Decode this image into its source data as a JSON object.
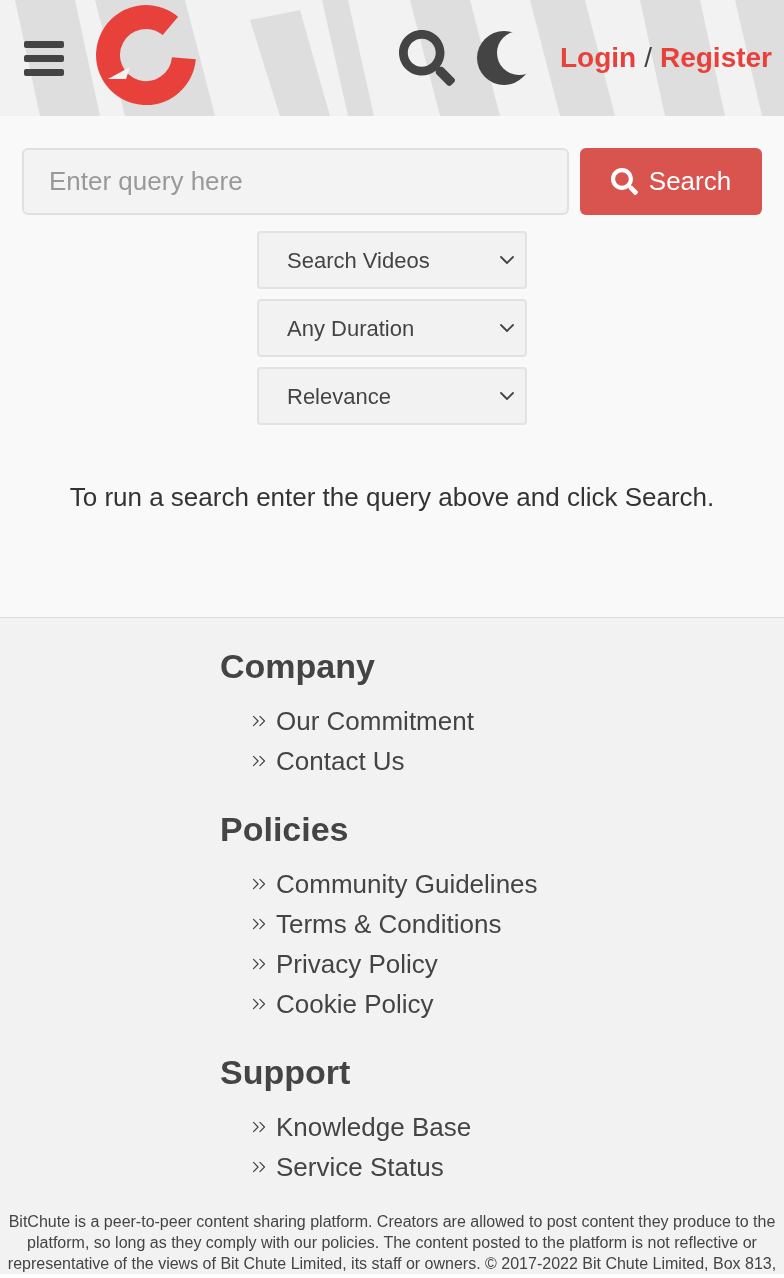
{
  "header": {
    "auth_links": [
      "Login",
      "Register"
    ],
    "separator": "/"
  },
  "search": {
    "placeholder": "Enter query here",
    "button": "Search",
    "filters": [
      "Search Videos",
      "Any Duration",
      "Relevance"
    ]
  },
  "message": "To run a search enter the query above and click Search.",
  "footer": {
    "sections": [
      {
        "heading": "Company",
        "links": [
          "Our Commitment",
          "Contact Us"
        ]
      },
      {
        "heading": "Policies",
        "links": [
          "Community Guidelines",
          "Terms & Conditions",
          "Privacy Policy",
          "Cookie Policy"
        ]
      },
      {
        "heading": "Support",
        "links": [
          "Knowledge Base",
          "Service Status"
        ]
      }
    ],
    "disclaimer": "BitChute is a peer-to-peer content sharing platform. Creators are allowed to post content they produce to the platform, so long as they comply with our policies. The content posted to the platform is not reflective or representative of the views of Bit Chute Limited, its staff or owners. © 2017-2022 Bit Chute Limited, Box 813,"
  }
}
